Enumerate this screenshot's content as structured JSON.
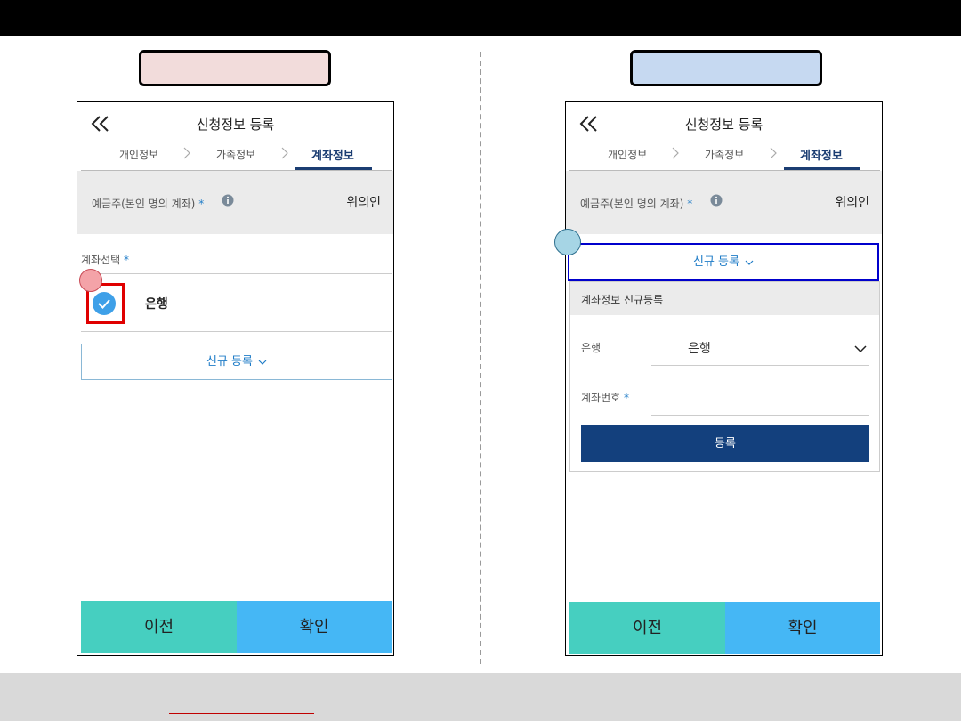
{
  "screen": {
    "header_title": "신청정보 등록",
    "steps": [
      "개인정보",
      "가족정보",
      "계좌정보"
    ],
    "owner_label": "예금주(본인 명의 계좌)",
    "required_mark": "*",
    "owner_value": "위의인",
    "prev_label": "이전",
    "ok_label": "확인",
    "new_reg_label": "신규 등록"
  },
  "left": {
    "account_select_label": "계좌선택",
    "bank_name": "은행"
  },
  "right": {
    "panel_title": "계좌정보 신규등록",
    "bank_label": "은행",
    "bank_value": "은행",
    "account_no_label": "계좌번호",
    "account_no_value": "",
    "submit_label": "등록"
  },
  "colors": {
    "label_left_bg": "#f2dcdb",
    "label_right_bg": "#c6d9f1",
    "accent_navy": "#1b3d72",
    "link_blue": "#1f7cc7",
    "prev_teal": "#46cfc0",
    "ok_blue": "#45b7f5",
    "highlight_red": "#e00000",
    "highlight_blue": "#0000cc"
  }
}
